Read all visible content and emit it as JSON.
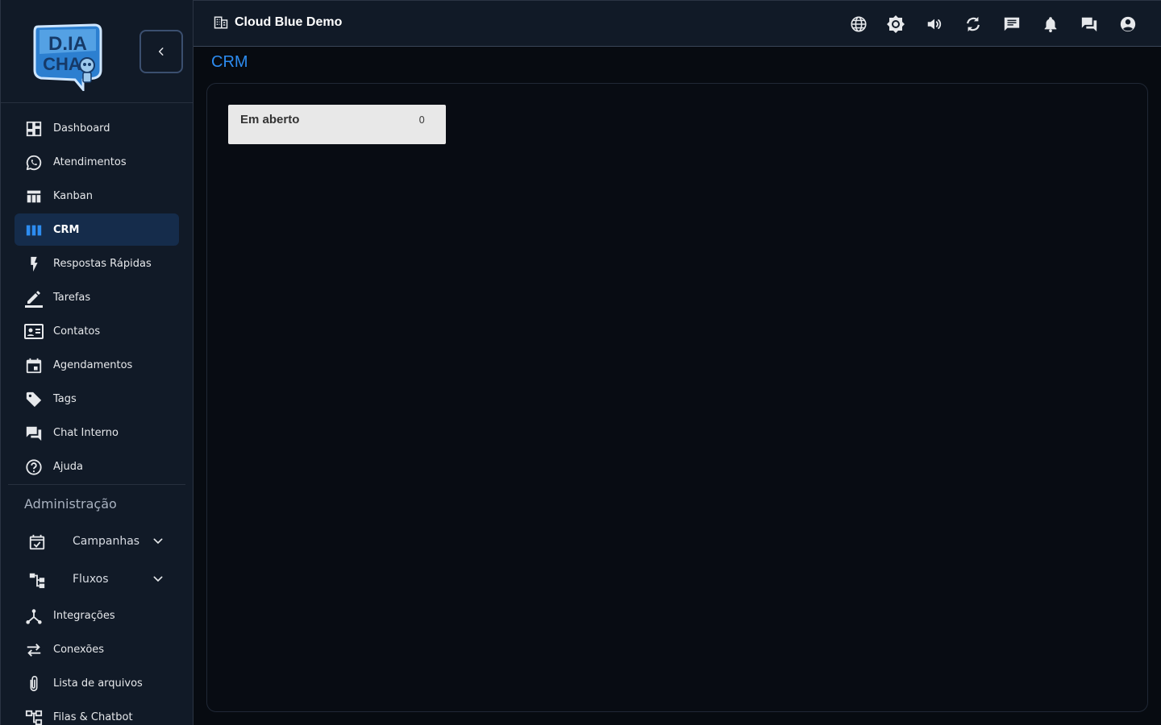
{
  "app": {
    "logo_text": "D.IA CHAT"
  },
  "topbar": {
    "company_name": "Cloud Blue Demo",
    "icons": [
      "language-icon",
      "brightness-icon",
      "volume-icon",
      "refresh-icon",
      "chat-icon",
      "notifications-icon",
      "forum-icon",
      "account-icon"
    ]
  },
  "sidebar": {
    "items": [
      {
        "label": "Dashboard",
        "icon": "dashboard-icon"
      },
      {
        "label": "Atendimentos",
        "icon": "whatsapp-icon"
      },
      {
        "label": "Kanban",
        "icon": "kanban-icon"
      },
      {
        "label": "CRM",
        "icon": "columns-icon",
        "active": true
      },
      {
        "label": "Respostas Rápidas",
        "icon": "flash-icon"
      },
      {
        "label": "Tarefas",
        "icon": "edit-icon"
      },
      {
        "label": "Contatos",
        "icon": "contacts-icon"
      },
      {
        "label": "Agendamentos",
        "icon": "calendar-icon"
      },
      {
        "label": "Tags",
        "icon": "tag-icon"
      },
      {
        "label": "Chat Interno",
        "icon": "forum-icon"
      },
      {
        "label": "Ajuda",
        "icon": "help-icon"
      }
    ],
    "admin_title": "Administração",
    "admin_groups": [
      {
        "label": "Campanhas",
        "icon": "event-check-icon"
      },
      {
        "label": "Fluxos",
        "icon": "flow-icon"
      }
    ],
    "admin_items": [
      {
        "label": "Integrações",
        "icon": "hub-icon"
      },
      {
        "label": "Conexões",
        "icon": "swap-icon"
      },
      {
        "label": "Lista de arquivos",
        "icon": "attach-icon"
      },
      {
        "label": "Filas & Chatbot",
        "icon": "tree-icon"
      }
    ]
  },
  "main": {
    "title": "CRM",
    "columns": [
      {
        "title": "Em aberto",
        "count": "0"
      }
    ]
  },
  "colors": {
    "accent": "#2d8cf0",
    "sidebar_bg": "#111a27",
    "active_bg": "#152c4b",
    "page_bg": "#070b11"
  }
}
